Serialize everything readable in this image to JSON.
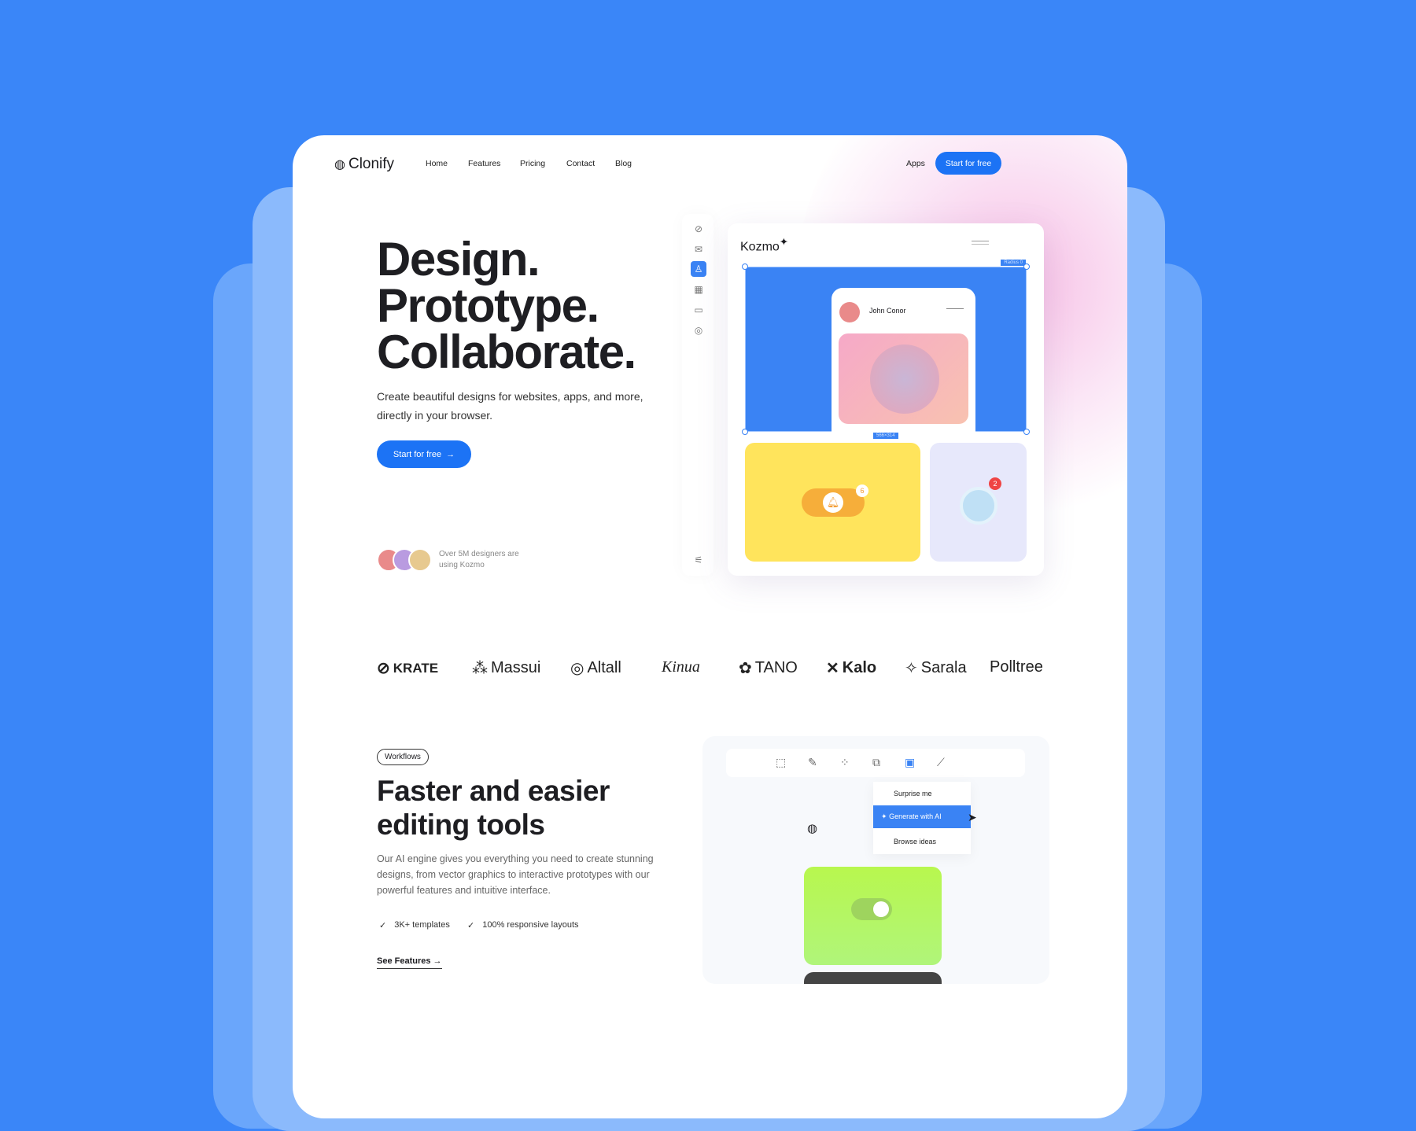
{
  "nav": {
    "brand": "Clonify",
    "links": [
      "Home",
      "Features",
      "Pricing",
      "Contact",
      "Blog"
    ],
    "apps": "Apps",
    "cta": "Start for free"
  },
  "hero": {
    "title": [
      "Design.",
      "Prototype.",
      "Collaborate."
    ],
    "subtitle": "Create beautiful designs for websites, apps, and more, directly in your browser.",
    "cta": "Start for free",
    "cta_icon": "arrow-right-icon",
    "social_proof": "Over 5M designers are using Kozmo"
  },
  "mockup": {
    "brand": "Kozmo",
    "radius_tag": "Radius 0",
    "size_tag": "566×314",
    "profile_name": "John Conor",
    "notification_count": "6",
    "avatar_badge": "2",
    "sidebar_icons": [
      "link-icon",
      "mail-icon",
      "user-icon",
      "grid-icon",
      "folder-icon",
      "support-icon"
    ],
    "accent": "#3a83f4"
  },
  "logos": [
    "KRATE",
    "Massui",
    "Altall",
    "Kinua",
    "TANO",
    "Kalo",
    "Sarala",
    "Polltree"
  ],
  "features": {
    "badge": "Workflows",
    "title": [
      "Faster and easier",
      "editing tools"
    ],
    "description": "Our AI engine gives you everything you need to create stunning designs, from vector graphics to interactive prototypes with our powerful features and intuitive interface.",
    "checks": [
      "3K+ templates",
      "100% responsive layouts"
    ],
    "link": "See Features",
    "menu": [
      "Surprise me",
      "Generate with AI",
      "Browse ideas"
    ],
    "tools": [
      "frame-icon",
      "brush-icon",
      "components-icon",
      "layers-icon",
      "image-icon",
      "path-icon"
    ]
  },
  "colors": {
    "background": "#3a86f8",
    "primary": "#1c73f5",
    "yellow": "#ffe45c",
    "green": "#b4f55c"
  }
}
